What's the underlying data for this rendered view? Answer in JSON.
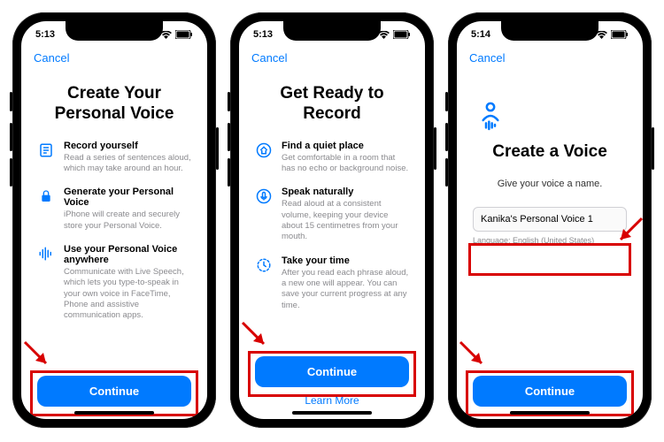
{
  "screens": [
    {
      "time": "5:13",
      "cancel": "Cancel",
      "title": "Create Your Personal Voice",
      "items": [
        {
          "label": "Record yourself",
          "desc": "Read a series of sentences aloud, which may take around an hour."
        },
        {
          "label": "Generate your Personal Voice",
          "desc": "iPhone will create and securely store your Personal Voice."
        },
        {
          "label": "Use your Personal Voice anywhere",
          "desc": "Communicate with Live Speech, which lets you type-to-speak in your own voice in FaceTime, Phone and assistive communication apps."
        }
      ],
      "continue": "Continue"
    },
    {
      "time": "5:13",
      "cancel": "Cancel",
      "title": "Get Ready to Record",
      "items": [
        {
          "label": "Find a quiet place",
          "desc": "Get comfortable in a room that has no echo or background noise."
        },
        {
          "label": "Speak naturally",
          "desc": "Read aloud at a consistent volume, keeping your device about 15 centimetres from your mouth."
        },
        {
          "label": "Take your time",
          "desc": "After you read each phrase aloud, a new one will appear. You can save your current progress at any time."
        }
      ],
      "continue": "Continue",
      "learn_more": "Learn More"
    },
    {
      "time": "5:14",
      "cancel": "Cancel",
      "title": "Create a Voice",
      "subtitle": "Give your voice a name.",
      "input": "Kanika's Personal Voice 1",
      "language": "Language: English (United States)",
      "continue": "Continue"
    }
  ]
}
